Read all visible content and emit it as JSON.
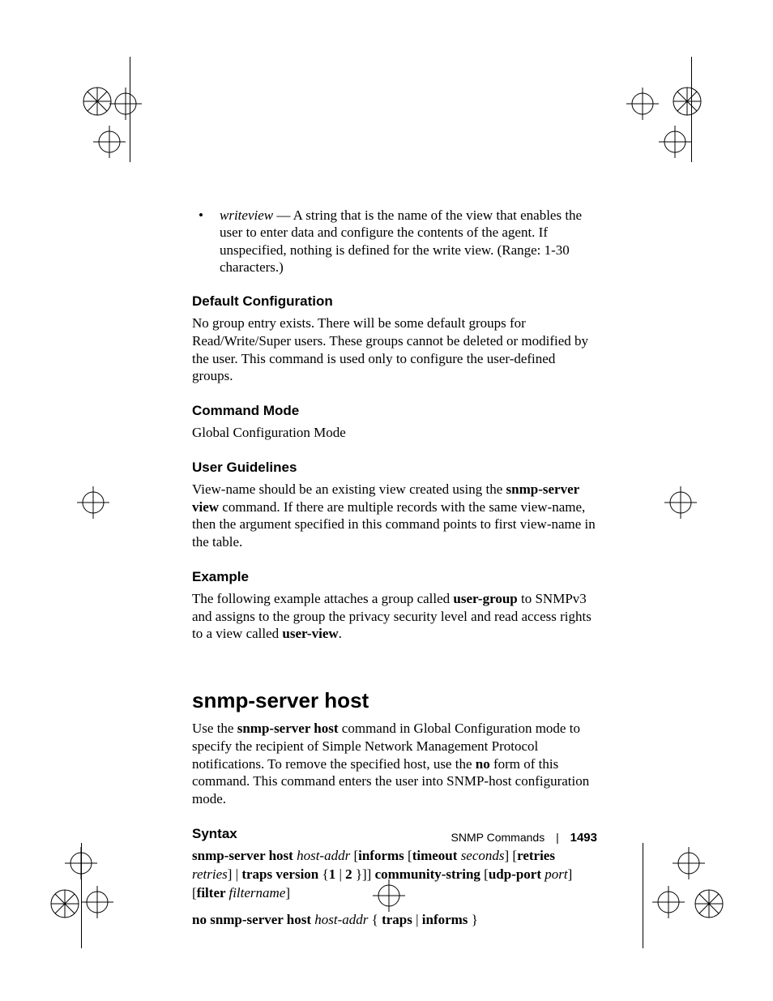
{
  "bullet": {
    "term": "writeview",
    "desc": " — A string that is the name of the view that enables the user to enter data and configure the contents of the agent. If unspecified, nothing is defined for the write view. (Range: 1-30 characters.)"
  },
  "sections": {
    "defaultConfig": {
      "heading": "Default Configuration",
      "body": "No group entry exists. There will be some default groups for Read/Write/Super users. These groups cannot be deleted or modified by the user. This command is used only to configure the user-defined groups."
    },
    "commandMode": {
      "heading": "Command Mode",
      "body": "Global Configuration Mode"
    },
    "userGuidelines": {
      "heading": "User Guidelines",
      "body_pre": "View-name should be an existing view created using the ",
      "body_bold": "snmp-server view",
      "body_post": " command. If there are multiple records with the same view-name, then the argument specified in this command points to first view-name in the table."
    },
    "example": {
      "heading": "Example",
      "body_pre": "The following example attaches a group called ",
      "body_b1": "user-group",
      "body_mid": " to SNMPv3 and assigns to the group the privacy security level and read access rights to a view called ",
      "body_b2": "user-view",
      "body_post": "."
    }
  },
  "command": {
    "title": "snmp-server host",
    "intro_pre": "Use the ",
    "intro_b1": "snmp-server host",
    "intro_mid": " command in Global Configuration mode to specify the recipient of Simple Network Management Protocol notifications. To remove the specified host, use the ",
    "intro_b2": "no",
    "intro_post": " form of this command. This command enters the user into SNMP-host configuration mode.",
    "syntax_heading": "Syntax",
    "s1": {
      "p1": "snmp-server host ",
      "i1": "host-addr",
      "p2": " [",
      "b1": "informs ",
      "p3": "[",
      "b2": "timeout ",
      "i2": "seconds",
      "p4": "] [",
      "b3": "retries ",
      "i3": "retries",
      "p5": "] | ",
      "b4": "traps version ",
      "p6": "{",
      "b5": "1 ",
      "p7": "| ",
      "b6": "2 ",
      "p8": "}]] ",
      "b7": "community-string ",
      "p9": "[",
      "b8": "udp-port ",
      "i4": "port",
      "p10": "] [",
      "b9": "filter ",
      "i5": "filtername",
      "p11": "]"
    },
    "s2": {
      "b1": "no snmp-server host ",
      "i1": "host-addr",
      "p1": " { ",
      "b2": "traps ",
      "p2": "| ",
      "b3": "informs ",
      "p3": "}"
    }
  },
  "footer": {
    "section": "SNMP Commands",
    "page": "1493"
  }
}
